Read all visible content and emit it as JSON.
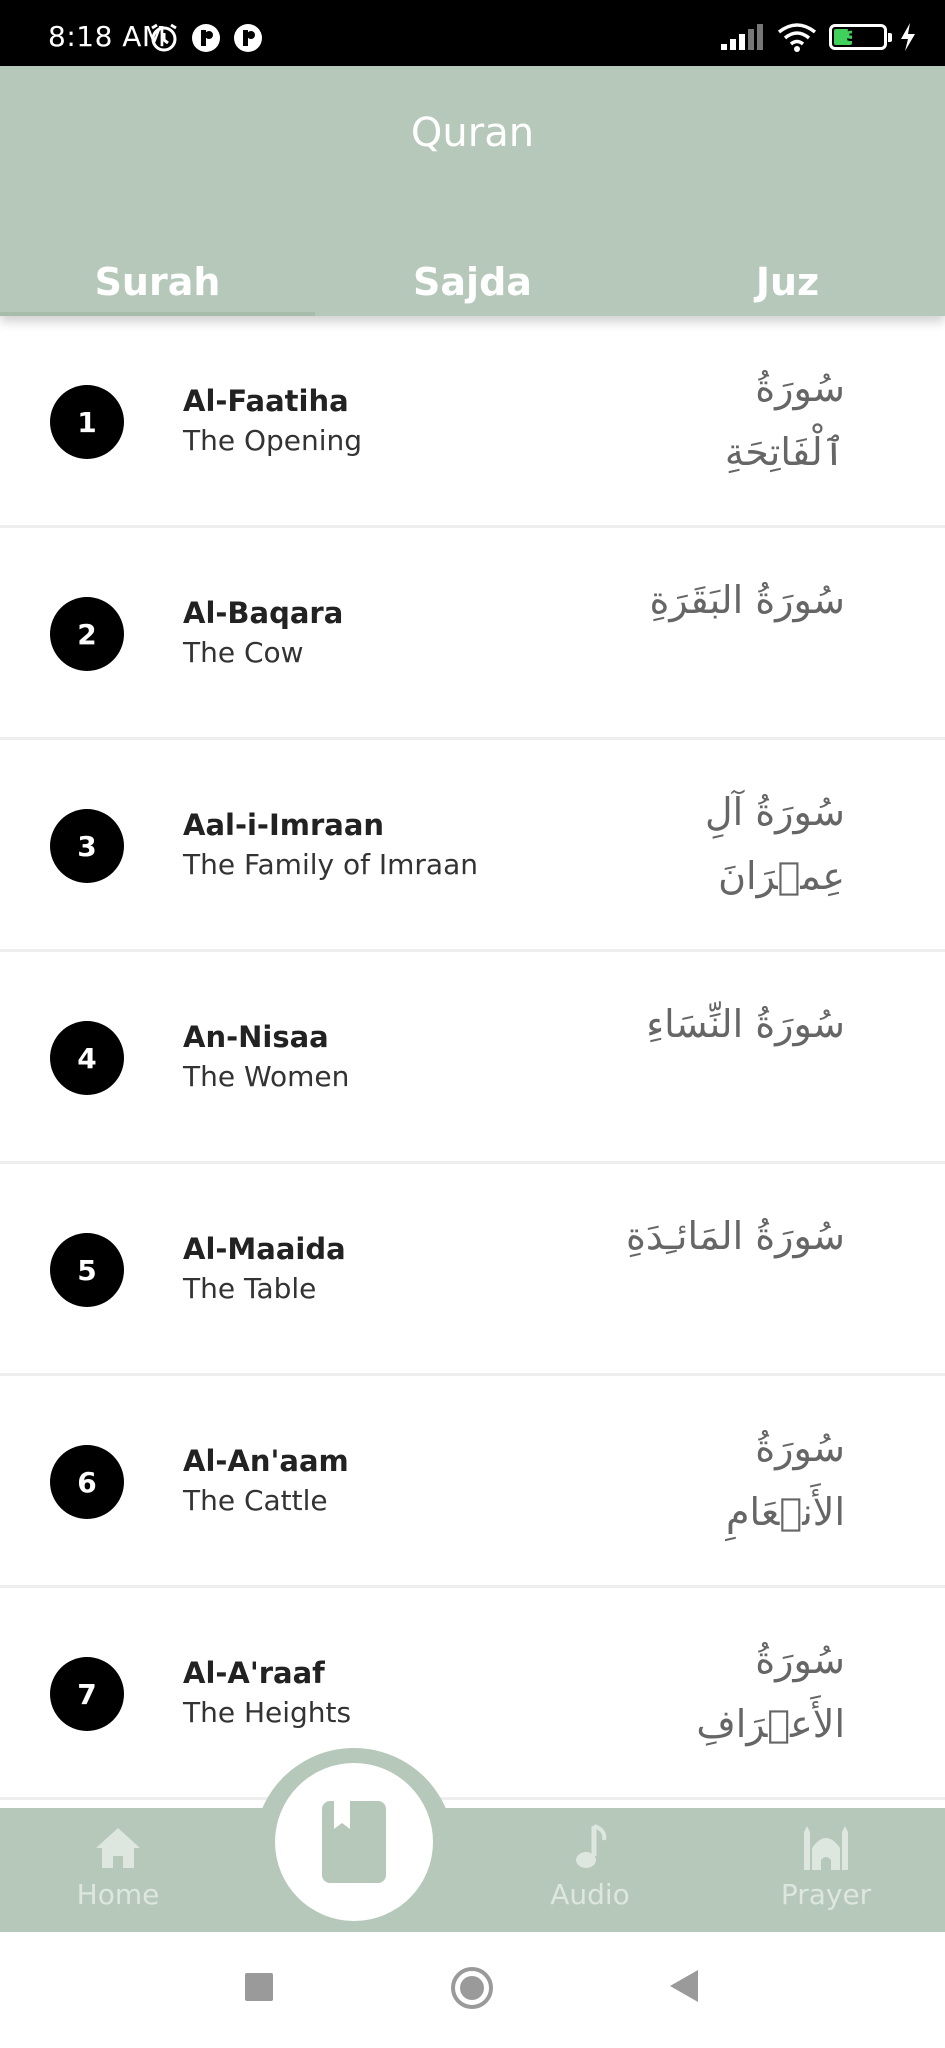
{
  "status_bar": {
    "time": "8:18 AM",
    "battery_level": "38",
    "battery_color": "#3fd15a"
  },
  "header": {
    "title": "Quran",
    "background": "#b5c8b9",
    "tabs": [
      {
        "label": "Surah",
        "active": true
      },
      {
        "label": "Sajda",
        "active": false
      },
      {
        "label": "Juz",
        "active": false
      }
    ]
  },
  "surahs": [
    {
      "number": "1",
      "name": "Al-Faatiha",
      "meaning": "The Opening",
      "arabic": "سُورَةُ ٱلْفَاتِحَةِ"
    },
    {
      "number": "2",
      "name": "Al-Baqara",
      "meaning": "The Cow",
      "arabic": "سُورَةُ البَقَرَةِ"
    },
    {
      "number": "3",
      "name": "Aal-i-Imraan",
      "meaning": "The Family of Imraan",
      "arabic": "سُورَةُ آلِ عِمۡرَانَ"
    },
    {
      "number": "4",
      "name": "An-Nisaa",
      "meaning": "The Women",
      "arabic": "سُورَةُ النِّسَاءِ"
    },
    {
      "number": "5",
      "name": "Al-Maaida",
      "meaning": "The Table",
      "arabic": "سُورَةُ المَائـِدَةِ"
    },
    {
      "number": "6",
      "name": "Al-An'aam",
      "meaning": "The Cattle",
      "arabic": "سُورَةُ الأَنۡعَامِ"
    },
    {
      "number": "7",
      "name": "Al-A'raaf",
      "meaning": "The Heights",
      "arabic": "سُورَةُ الأَعۡرَافِ"
    }
  ],
  "bottom_nav": {
    "home": "Home",
    "audio": "Audio",
    "prayer": "Prayer",
    "center_icon": "book-icon"
  }
}
